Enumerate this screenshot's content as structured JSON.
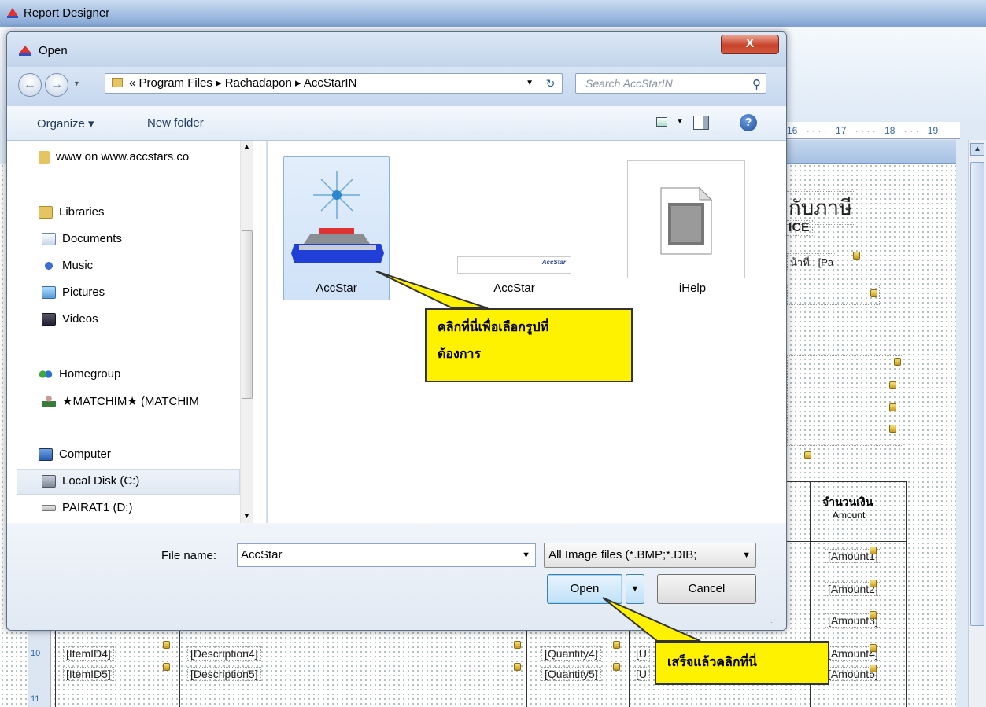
{
  "app": {
    "title": "Report Designer",
    "ruler_ticks": [
      "16",
      "17",
      "18",
      "19"
    ]
  },
  "report": {
    "header_title_th": "กับภาษี",
    "header_title_en": "ICE",
    "page_label": "น้าที่ : [Pa",
    "col_amount_th": "จำนวนเงิน",
    "col_amount_en": "Amount",
    "rows": [
      {
        "line": "",
        "item": "",
        "desc": "",
        "qty": "",
        "unit": "",
        "amount": "[Amount1]"
      },
      {
        "line": "",
        "item": "",
        "desc": "",
        "qty": "",
        "unit": "",
        "amount": "[Amount2]"
      },
      {
        "line": "",
        "item": "",
        "desc": "",
        "qty": "",
        "unit": "",
        "amount": "[Amount3]"
      },
      {
        "line": "10",
        "item": "[ItemID4]",
        "desc": "[Description4]",
        "qty": "[Quantity4]",
        "unit": "[U",
        "amount": "[Amount4]"
      },
      {
        "line": "",
        "item": "[ItemID5]",
        "desc": "[Description5]",
        "qty": "[Quantity5]",
        "unit": "[U",
        "amount": "[Amount5]"
      },
      {
        "line": "11",
        "item": "",
        "desc": "",
        "qty": "",
        "unit": "",
        "amount": ""
      }
    ]
  },
  "dialog": {
    "title": "Open",
    "close": "X",
    "breadcrumb": "«  Program Files  ▸  Rachadapon  ▸  AccStarIN",
    "search_placeholder": "Search AccStarIN",
    "toolbar": {
      "organize": "Organize ▾",
      "new_folder": "New folder",
      "help": "?"
    },
    "nav_items": [
      {
        "label": "www on www.accstars.co",
        "icon": "folder-icon"
      },
      {
        "label": "Libraries",
        "icon": "libraries-icon"
      },
      {
        "label": "Documents",
        "icon": "documents-icon"
      },
      {
        "label": "Music",
        "icon": "music-icon"
      },
      {
        "label": "Pictures",
        "icon": "pictures-icon"
      },
      {
        "label": "Videos",
        "icon": "videos-icon"
      },
      {
        "label": "Homegroup",
        "icon": "homegroup-icon"
      },
      {
        "label": "★MATCHIM★ (MATCHIM",
        "icon": "user-icon"
      },
      {
        "label": "Computer",
        "icon": "computer-icon"
      },
      {
        "label": "Local Disk (C:)",
        "icon": "local-disk-icon"
      },
      {
        "label": "PAIRAT1 (D:)",
        "icon": "drive-icon"
      }
    ],
    "files": [
      {
        "label": "AccStar",
        "icon": "accstar-logo-image",
        "selected": true
      },
      {
        "label": "AccStar",
        "icon": "accstar-banner-image",
        "selected": false
      },
      {
        "label": "iHelp",
        "icon": "image-file-icon",
        "selected": false
      }
    ],
    "banner_text": "AccStar",
    "file_name_label": "File name:",
    "file_name_value": "AccStar",
    "filter_value": "All Image files (*.BMP;*.DIB;",
    "open_label": "Open",
    "cancel_label": "Cancel"
  },
  "callouts": {
    "select_image": [
      "คลิกที่นี่เพื่อเลือกรูปที่",
      "ต้องการ"
    ],
    "done_click": "เสร็จแล้วคลิกที่นี่"
  },
  "colors": {
    "callout": "#fff200",
    "close_button": "#c8432b",
    "selection": "#cfe2f8"
  }
}
